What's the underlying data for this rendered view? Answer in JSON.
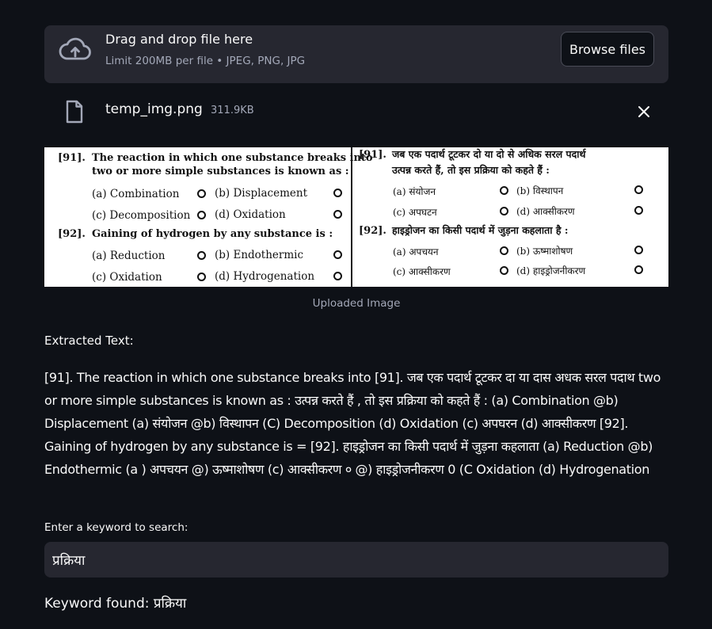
{
  "uploader": {
    "title": "Drag and drop file here",
    "limit_text": "Limit 200MB per file • JPEG, PNG, JPG",
    "browse_label": "Browse files",
    "icon": "cloud-upload-icon"
  },
  "file": {
    "name": "temp_img.png",
    "size": "311.9KB",
    "icon": "file-icon",
    "close_icon": "close-icon"
  },
  "image": {
    "left": {
      "q91_num": "[91].",
      "q91_line1": "The reaction in which one substance breaks into",
      "q91_line2": "two or more simple substances is known as :",
      "q91_a": "(a)  Combination",
      "q91_b": "(b)  Displacement",
      "q91_c": "(c)  Decomposition",
      "q91_d": "(d)  Oxidation",
      "q92_num": "[92].",
      "q92_line1": "Gaining of hydrogen by any substance is :",
      "q92_a": "(a)  Reduction",
      "q92_b": "(b)  Endothermic",
      "q92_c": "(c)  Oxidation",
      "q92_d": "(d)  Hydrogenation"
    },
    "right": {
      "q91_num": "[91].",
      "q91_line1": "जब एक पदार्थ टूटकर दो या दो से अधिक सरल पदार्थ",
      "q91_line2": "उत्पन्न करते हैं, तो इस प्रक्रिया को कहते हैं :",
      "q91_a": "(a)  संयोजन",
      "q91_b": "(b)  विस्थापन",
      "q91_c": "(c)  अपघटन",
      "q91_d": "(d)  आक्सीकरण",
      "q92_num": "[92].",
      "q92_line1": "हाइड्रोजन का किसी पदार्थ में जुड़ना कहलाता है :",
      "q92_a": "(a)  अपचयन",
      "q92_b": "(b)  ऊष्माशोषण",
      "q92_c": "(c)  आक्सीकरण",
      "q92_d": "(d)  हाइड्रोजनीकरण"
    },
    "caption": "Uploaded Image"
  },
  "extracted": {
    "label": "Extracted Text:",
    "text": "[91]. The reaction in which one substance breaks into [91]. जब एक पदार्थ टूटकर दा या दास अधक सरल पदाथ two or more simple substances is known as : उत्पन्न करते हैं , तो इस प्रक्रिया को कहते हैं : (a) Combination @b) Displacement (a) संयोजन @b) विस्थापन (C) Decomposition (d) Oxidation (c) अपघरन (d) आक्सीकरण [92]. Gaining of hydrogen by any substance is = [92]. हाइड्रोजन का किसी पदार्थ में जुड़ना कहलाता (a) Reduction @b) Endothermic (a ) अपचयन @) ऊष्माशोषण (c) आक्सीकरण ० @) हाइड्रोजनीकरण 0 (C Oxidation (d) Hydrogenation"
  },
  "search": {
    "label": "Enter a keyword to search:",
    "value": "प्रक्रिया"
  },
  "result": {
    "text": "Keyword found: प्रक्रिया"
  }
}
